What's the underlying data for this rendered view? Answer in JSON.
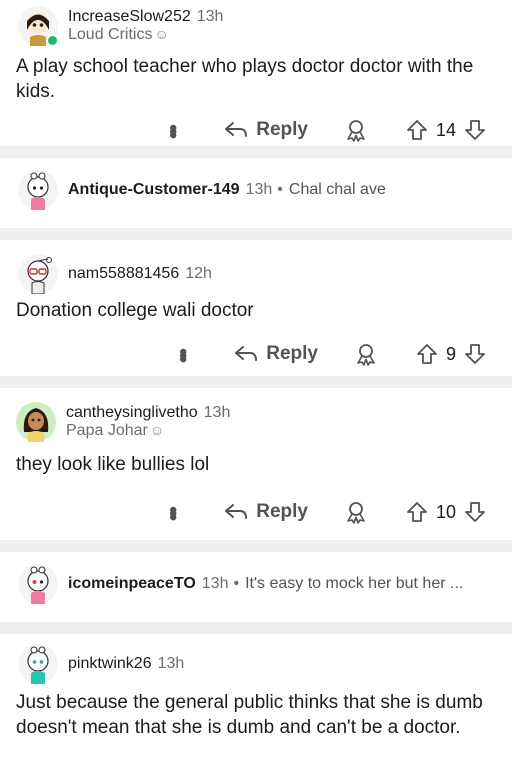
{
  "comments": [
    {
      "username": "IncreaseSlow252",
      "time": "13h",
      "flair": "Loud Critics",
      "body": "A play school teacher who plays doctor doctor with the kids.",
      "reply_label": "Reply",
      "score": "14",
      "online": true
    },
    {
      "username": "Antique-Customer-149",
      "time": "13h",
      "preview": "Chal chal ave",
      "collapsed": true
    },
    {
      "username": "nam558881456",
      "time": "12h",
      "body": "Donation college wali doctor",
      "reply_label": "Reply",
      "score": "9"
    },
    {
      "username": "cantheysinglivetho",
      "time": "13h",
      "flair": "Papa Johar",
      "body": "they look like bullies lol",
      "reply_label": "Reply",
      "score": "10"
    },
    {
      "username": "icomeinpeaceTO",
      "time": "13h",
      "preview": "It's easy to mock her but her ...",
      "collapsed": true
    },
    {
      "username": "pinktwink26",
      "time": "13h",
      "body": "Just because the general public thinks that she is dumb doesn't mean that she is dumb and can't be a doctor."
    }
  ],
  "separator_bullet": "•",
  "colors": {
    "separator": "#edeff1",
    "meta": "#6a6d70",
    "online": "#22b573"
  },
  "icons": [
    "overflow-dots-icon",
    "reply-arrow-icon",
    "award-icon",
    "upvote-icon",
    "downvote-icon",
    "snoo-avatar-icon",
    "flair-snoo-icon"
  ]
}
